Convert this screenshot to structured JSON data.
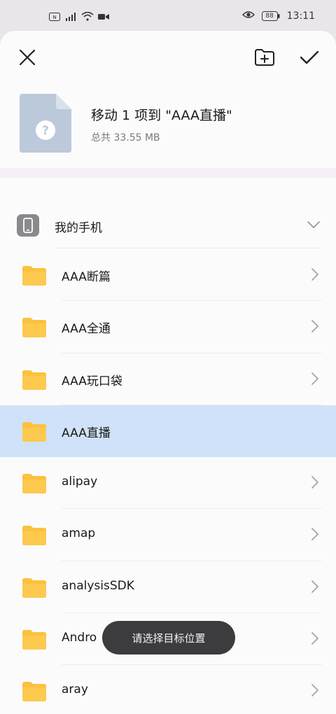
{
  "status_bar": {
    "time": "13:11",
    "battery": "88",
    "left_icons": [
      "nfc-icon",
      "signal-icon",
      "wifi-icon",
      "video-icon"
    ],
    "right_icons": [
      "eye-icon",
      "battery-icon"
    ]
  },
  "toolbar": {
    "close_icon": "close-icon",
    "new_folder_icon": "new-folder-icon",
    "confirm_icon": "check-icon"
  },
  "summary": {
    "title": "移动 1 项到 \"AAA直播\"",
    "subtitle": "总共 33.55 MB",
    "file_icon": "unknown-file-icon"
  },
  "location": {
    "label": "我的手机",
    "icon": "phone-icon"
  },
  "folders": [
    {
      "name": "AAA断篇",
      "selected": false
    },
    {
      "name": "AAA全通",
      "selected": false
    },
    {
      "name": "AAA玩口袋",
      "selected": false
    },
    {
      "name": "AAA直播",
      "selected": true
    },
    {
      "name": "alipay",
      "selected": false
    },
    {
      "name": "amap",
      "selected": false
    },
    {
      "name": "analysisSDK",
      "selected": false
    },
    {
      "name": "Andro",
      "selected": false
    },
    {
      "name": "aray",
      "selected": false
    }
  ],
  "toast": {
    "text": "请选择目标位置"
  },
  "colors": {
    "folder": "#fcc13f",
    "selected_row": "#d0e2f9",
    "toast_bg": "#3c3c3e"
  }
}
